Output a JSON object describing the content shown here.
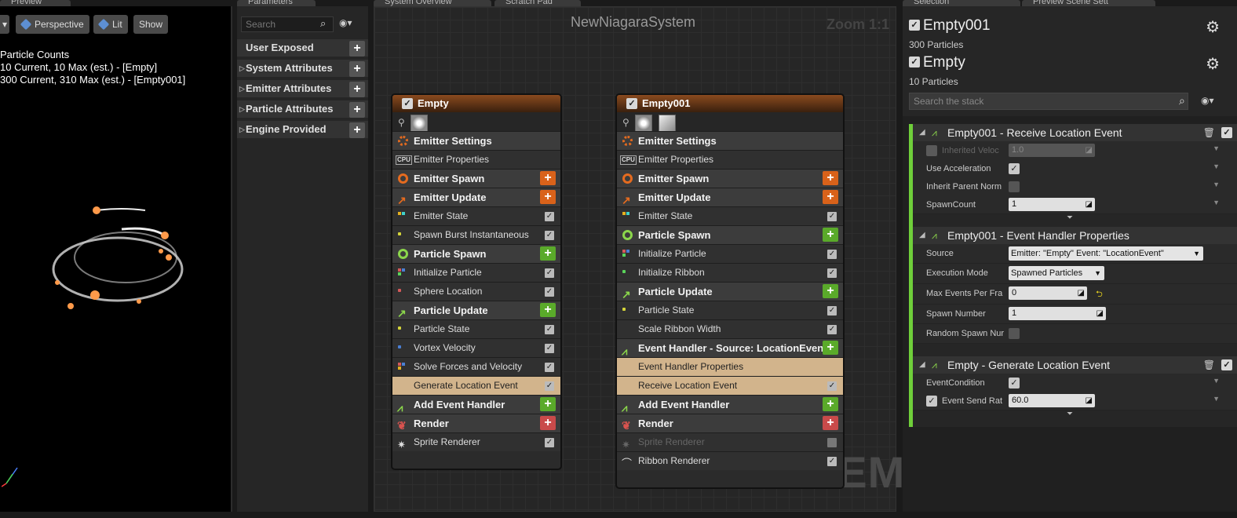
{
  "tabs": {
    "preview": "Preview",
    "parameters": "Parameters",
    "system_overview": "System Overview",
    "scratch_pad": "Scratch Pad",
    "selection": "Selection",
    "preview_scene": "Preview Scene Sett"
  },
  "viewport": {
    "buttons": {
      "perspective": "Perspective",
      "lit": "Lit",
      "show": "Show"
    },
    "stats_title": "Particle Counts",
    "stats": [
      "10 Current, 10 Max (est.) - [Empty]",
      "300 Current, 310 Max (est.) - [Empty001]"
    ]
  },
  "parameters": {
    "search_placeholder": "Search",
    "groups": [
      {
        "label": "User Exposed",
        "expandable": false
      },
      {
        "label": "System Attributes",
        "expandable": true
      },
      {
        "label": "Emitter Attributes",
        "expandable": true
      },
      {
        "label": "Particle Attributes",
        "expandable": true
      },
      {
        "label": "Engine Provided",
        "expandable": true
      }
    ]
  },
  "graph": {
    "title": "NewNiagaraSystem",
    "zoom": "Zoom 1:1",
    "watermark": "SYSTEM",
    "nodes": [
      {
        "name": "Empty",
        "rows": [
          "Emitter Settings",
          "Emitter Properties",
          "Emitter Spawn",
          "Emitter Update",
          "Emitter State",
          "Spawn Burst Instantaneous",
          "Particle Spawn",
          "Initialize Particle",
          "Sphere Location",
          "Particle Update",
          "Particle State",
          "Vortex Velocity",
          "Solve Forces and Velocity",
          "Generate Location Event",
          "Add Event Handler",
          "Render",
          "Sprite Renderer"
        ]
      },
      {
        "name": "Empty001",
        "rows": [
          "Emitter Settings",
          "Emitter Properties",
          "Emitter Spawn",
          "Emitter Update",
          "Emitter State",
          "Particle Spawn",
          "Initialize Particle",
          "Initialize Ribbon",
          "Particle Update",
          "Particle State",
          "Scale Ribbon Width",
          "Event Handler - Source: LocationEvent",
          "Event Handler Properties",
          "Receive Location Event",
          "Add Event Handler",
          "Render",
          "Sprite Renderer",
          "Ribbon Renderer"
        ]
      }
    ]
  },
  "selection": {
    "emitters": [
      {
        "name": "Empty001",
        "particles": "300 Particles"
      },
      {
        "name": "Empty",
        "particles": "10 Particles"
      }
    ],
    "search_placeholder": "Search the stack",
    "sections": [
      {
        "title": "Empty001 - Receive Location Event",
        "params": [
          {
            "label": "Inherited Veloc",
            "value": "1.0"
          },
          {
            "label": "Use Acceleration"
          },
          {
            "label": "Inherit Parent Norm"
          },
          {
            "label": "SpawnCount",
            "value": "1"
          }
        ]
      },
      {
        "title": "Empty001 - Event Handler Properties",
        "params": [
          {
            "label": "Source",
            "value": "Emitter: \"Empty\" Event: \"LocationEvent\""
          },
          {
            "label": "Execution Mode",
            "value": "Spawned Particles"
          },
          {
            "label": "Max Events Per Fra",
            "value": "0"
          },
          {
            "label": "Spawn Number",
            "value": "1"
          },
          {
            "label": "Random Spawn Nur"
          }
        ]
      },
      {
        "title": "Empty - Generate Location Event",
        "params": [
          {
            "label": "EventCondition"
          },
          {
            "label": "Event Send Rat",
            "value": "60.0"
          }
        ]
      }
    ]
  },
  "colors": {
    "accent_orange": "#d9621a",
    "accent_green": "#5aaa2a",
    "render_red": "#c94a4a",
    "selected_row": "#d2b48c",
    "stack_bar": "#6fcf3a"
  }
}
